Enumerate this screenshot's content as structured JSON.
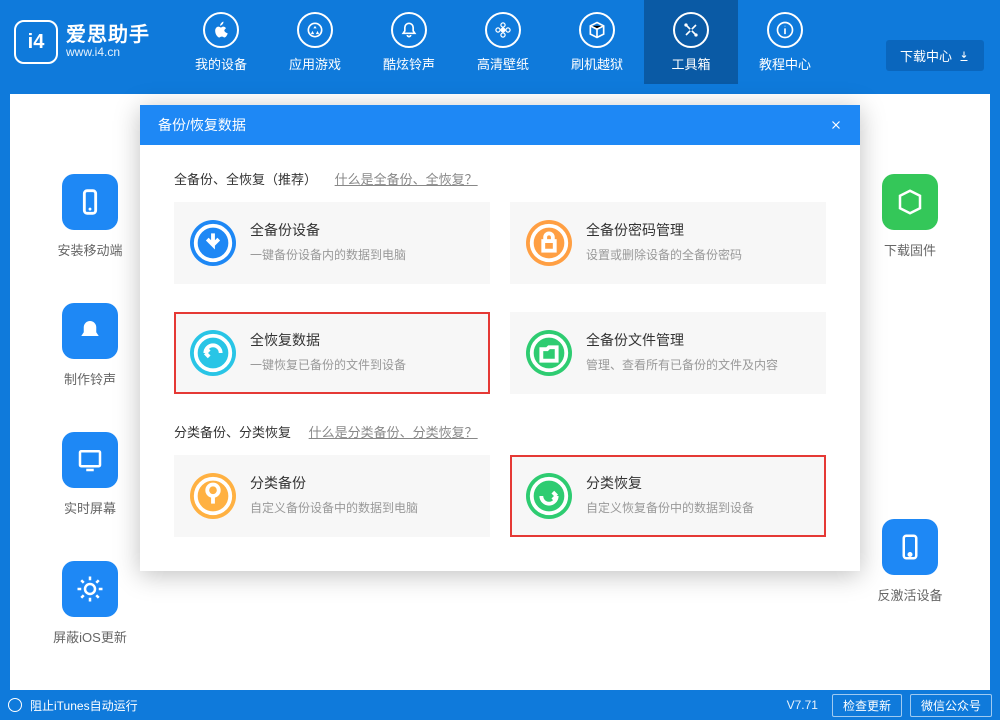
{
  "app": {
    "name_cn": "爱思助手",
    "name_en": "www.i4.cn"
  },
  "winbar": [
    "shirt",
    "line",
    "min",
    "max",
    "close"
  ],
  "nav": [
    {
      "label": "我的设备",
      "icon": "apple"
    },
    {
      "label": "应用游戏",
      "icon": "app"
    },
    {
      "label": "酷炫铃声",
      "icon": "bell"
    },
    {
      "label": "高清壁纸",
      "icon": "flower"
    },
    {
      "label": "刷机越狱",
      "icon": "box"
    },
    {
      "label": "工具箱",
      "icon": "tools",
      "active": true
    },
    {
      "label": "教程中心",
      "icon": "info"
    }
  ],
  "download_center": "下载中心",
  "side_left": [
    {
      "label": "安装移动端",
      "color": "#1e88f5"
    },
    {
      "label": "制作铃声",
      "color": "#1e88f5"
    },
    {
      "label": "实时屏幕",
      "color": "#1e88f5"
    },
    {
      "label": "屏蔽iOS更新",
      "color": "#1e88f5"
    }
  ],
  "side_right": [
    {
      "label": "下载固件",
      "color": "#34c759"
    },
    {
      "label": "反激活设备",
      "color": "#1e88f5"
    }
  ],
  "modal": {
    "title": "备份/恢复数据",
    "section1": {
      "title": "全备份、全恢复（推荐）",
      "help": "什么是全备份、全恢复？"
    },
    "section2": {
      "title": "分类备份、分类恢复",
      "help": "什么是分类备份、分类恢复？"
    },
    "cards1": [
      {
        "title": "全备份设备",
        "sub": "一键备份设备内的数据到电脑",
        "color": "#1e88f5"
      },
      {
        "title": "全备份密码管理",
        "sub": "设置或删除设备的全备份密码",
        "color": "#ff9f43"
      }
    ],
    "cards2": [
      {
        "title": "全恢复数据",
        "sub": "一键恢复已备份的文件到设备",
        "color": "#29c5e6",
        "hl": true
      },
      {
        "title": "全备份文件管理",
        "sub": "管理、查看所有已备份的文件及内容",
        "color": "#2ecc71"
      }
    ],
    "cards3": [
      {
        "title": "分类备份",
        "sub": "自定义备份设备中的数据到电脑",
        "color": "#ffb142"
      },
      {
        "title": "分类恢复",
        "sub": "自定义恢复备份中的数据到设备",
        "color": "#2ecc71",
        "hl": true
      }
    ]
  },
  "footer": {
    "itunes": "阻止iTunes自动运行",
    "version": "V7.71",
    "check": "检查更新",
    "wechat": "微信公众号"
  }
}
